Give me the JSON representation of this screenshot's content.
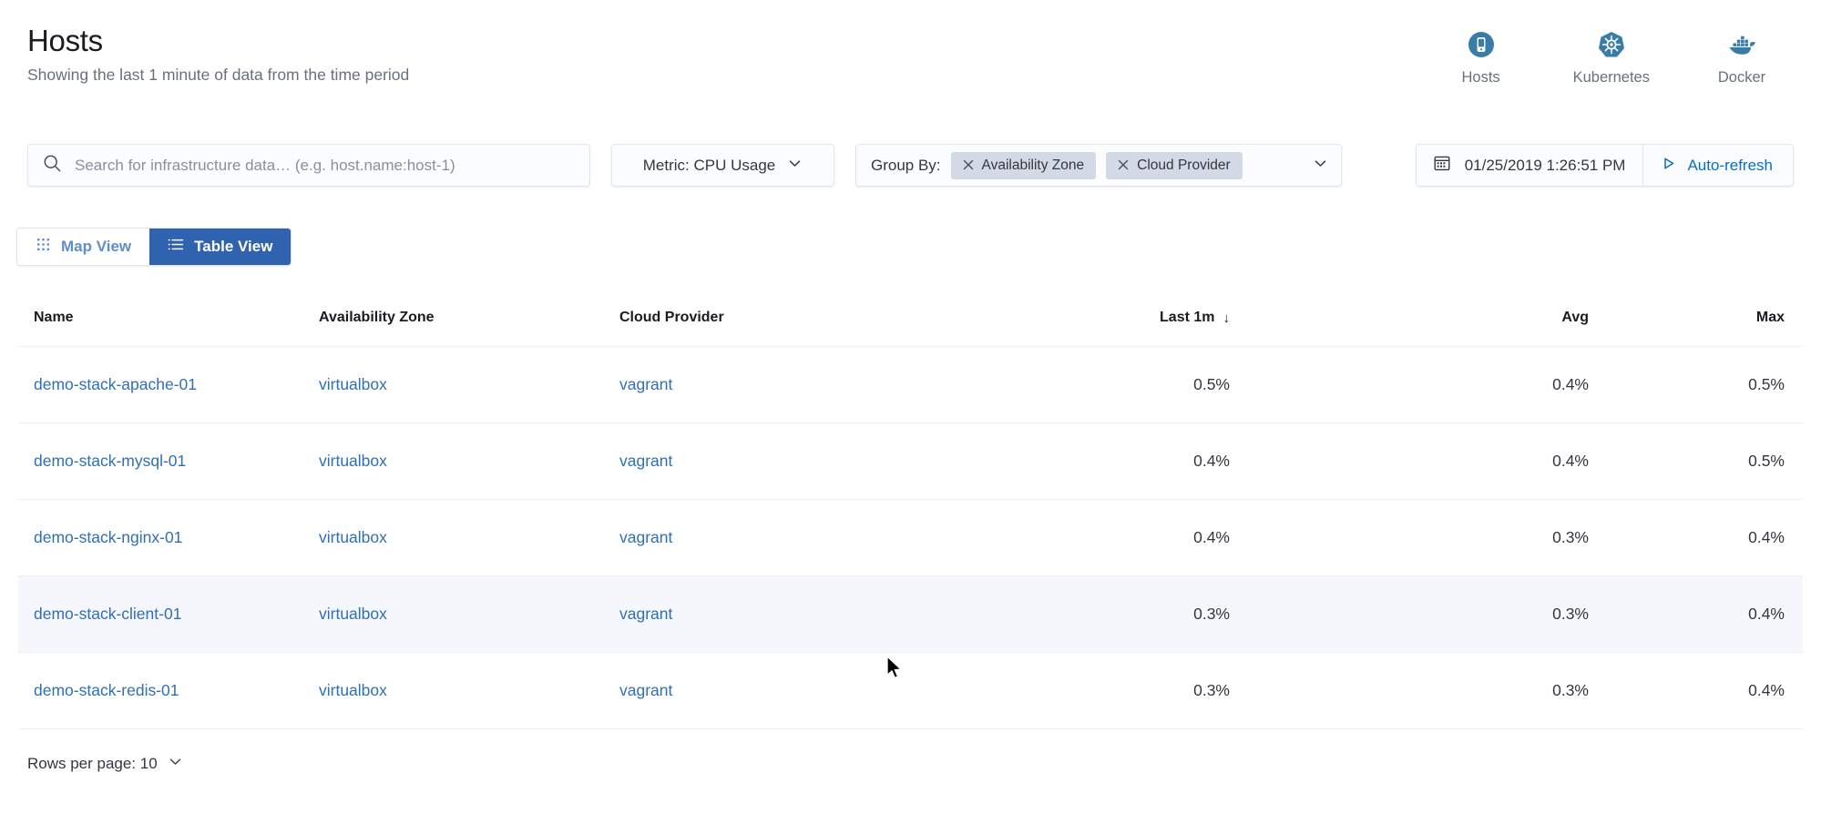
{
  "header": {
    "title": "Hosts",
    "subtitle": "Showing the last 1 minute of data from the time period",
    "nav_icons": [
      {
        "icon": "hosts-icon",
        "label": "Hosts"
      },
      {
        "icon": "kubernetes-icon",
        "label": "Kubernetes"
      },
      {
        "icon": "docker-icon",
        "label": "Docker"
      }
    ]
  },
  "filters": {
    "search": {
      "icon": "search-icon",
      "placeholder": "Search for infrastructure data… (e.g. host.name:host-1)",
      "value": ""
    },
    "metric": {
      "label": "Metric: CPU Usage",
      "caret": "chevron-down-icon"
    },
    "group_by": {
      "label": "Group By:",
      "pills": [
        {
          "remove": "×",
          "label": "Availability Zone"
        },
        {
          "remove": "×",
          "label": "Cloud Provider"
        }
      ],
      "caret": "chevron-down-icon"
    },
    "datetime": {
      "icon": "calendar-icon",
      "value": "01/25/2019 1:26:51 PM",
      "refresh_icon": "play-icon",
      "refresh_label": "Auto-refresh"
    }
  },
  "view_toggle": {
    "options": [
      {
        "icon": "grid-icon",
        "label": "Map View",
        "active": false
      },
      {
        "icon": "list-icon",
        "label": "Table View",
        "active": true
      }
    ]
  },
  "table": {
    "columns": [
      {
        "key": "name",
        "label": "Name",
        "align": "left"
      },
      {
        "key": "az",
        "label": "Availability Zone",
        "align": "left"
      },
      {
        "key": "cp",
        "label": "Cloud Provider",
        "align": "left"
      },
      {
        "key": "last1m",
        "label": "Last 1m",
        "align": "right",
        "sorted": true,
        "sort_dir": "↓"
      },
      {
        "key": "avg",
        "label": "Avg",
        "align": "right"
      },
      {
        "key": "max",
        "label": "Max",
        "align": "right"
      }
    ],
    "rows": [
      {
        "name": "demo-stack-apache-01",
        "az": "virtualbox",
        "cp": "vagrant",
        "last1m": "0.5%",
        "avg": "0.4%",
        "max": "0.5%",
        "highlighted": false
      },
      {
        "name": "demo-stack-mysql-01",
        "az": "virtualbox",
        "cp": "vagrant",
        "last1m": "0.4%",
        "avg": "0.4%",
        "max": "0.5%",
        "highlighted": false
      },
      {
        "name": "demo-stack-nginx-01",
        "az": "virtualbox",
        "cp": "vagrant",
        "last1m": "0.4%",
        "avg": "0.3%",
        "max": "0.4%",
        "highlighted": false
      },
      {
        "name": "demo-stack-client-01",
        "az": "virtualbox",
        "cp": "vagrant",
        "last1m": "0.3%",
        "avg": "0.3%",
        "max": "0.4%",
        "highlighted": true
      },
      {
        "name": "demo-stack-redis-01",
        "az": "virtualbox",
        "cp": "vagrant",
        "last1m": "0.3%",
        "avg": "0.3%",
        "max": "0.4%",
        "highlighted": false
      }
    ]
  },
  "footer": {
    "rows_per_page_label": "Rows per page: 10",
    "caret": "chevron-down-icon"
  },
  "colors": {
    "accent_blue": "#0671c4",
    "link_blue": "#2f6fb4",
    "active_tab_bg": "#2f63b0",
    "pill_bg": "#d3dae6",
    "row_highlight": "#f5f7fc",
    "text_primary": "#343741",
    "text_muted": "#69707d",
    "icon_blue": "#3a7ca8"
  }
}
